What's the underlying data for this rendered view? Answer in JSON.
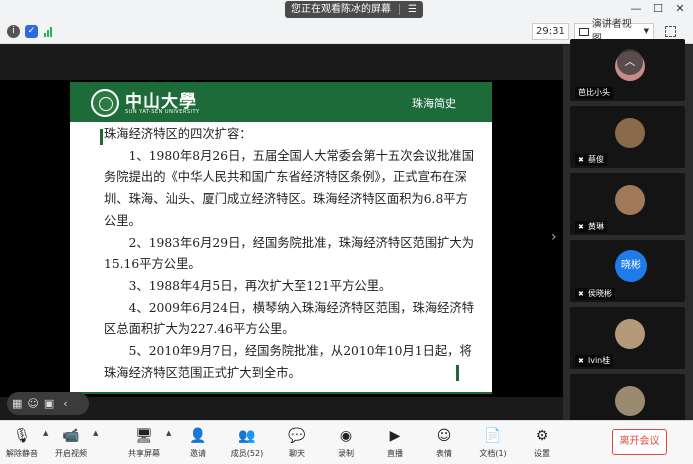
{
  "top": {
    "share_text": "您正在观看陈冰的屏幕",
    "share_icon": "menu-icon"
  },
  "status": {
    "timer": "29:31",
    "presenter_view": "演讲者视图",
    "network": "signal-icon"
  },
  "slide": {
    "logo_cn": "中山大學",
    "logo_en": "SUN YAT-SEN UNIVERSITY",
    "section": "珠海简史",
    "heading": "珠海经济特区的四次扩容：",
    "paragraphs": [
      "1、1980年8月26日，五届全国人大常委会第十五次会议批准国务院提出的《中华人民共和国广东省经济特区条例》，正式宣布在深圳、珠海、汕头、厦门成立经济特区。珠海经济特区面积为6.8平方公里。",
      "2、1983年6月29日，经国务院批准，珠海经济特区范围扩大为15.16平方公里。",
      "3、1988年4月5日，再次扩大至121平方公里。",
      "4、2009年6月24日，横琴纳入珠海经济特区范围，珠海经济特区总面积扩大为227.46平方公里。",
      "5、2010年9月7日，经国务院批准，从2010年10月1日起，将珠海经济特区范围正式扩大到全市。"
    ]
  },
  "participants": [
    {
      "name": "芭比小头",
      "avatar_color": "#c98a8a",
      "label": ""
    },
    {
      "name": "蔡俊",
      "avatar_color": "#8a6a4a",
      "label": ""
    },
    {
      "name": "黄琳",
      "avatar_color": "#a0785a",
      "label": ""
    },
    {
      "name": "侯晓彬",
      "avatar_color": "#1e7be8",
      "label": "晓彬"
    },
    {
      "name": "lvin桂",
      "avatar_color": "#b59a7a",
      "label": ""
    },
    {
      "name": "",
      "avatar_color": "#9a8a70",
      "label": ""
    }
  ],
  "toolbar": {
    "unmute": "解除静音",
    "video": "开启视频",
    "share": "共享屏幕",
    "invite": "邀请",
    "members": "成员(52)",
    "chat": "聊天",
    "record": "录制",
    "live": "直播",
    "reaction": "表情",
    "docs": "文档(1)",
    "settings": "设置",
    "leave": "离开会议"
  }
}
